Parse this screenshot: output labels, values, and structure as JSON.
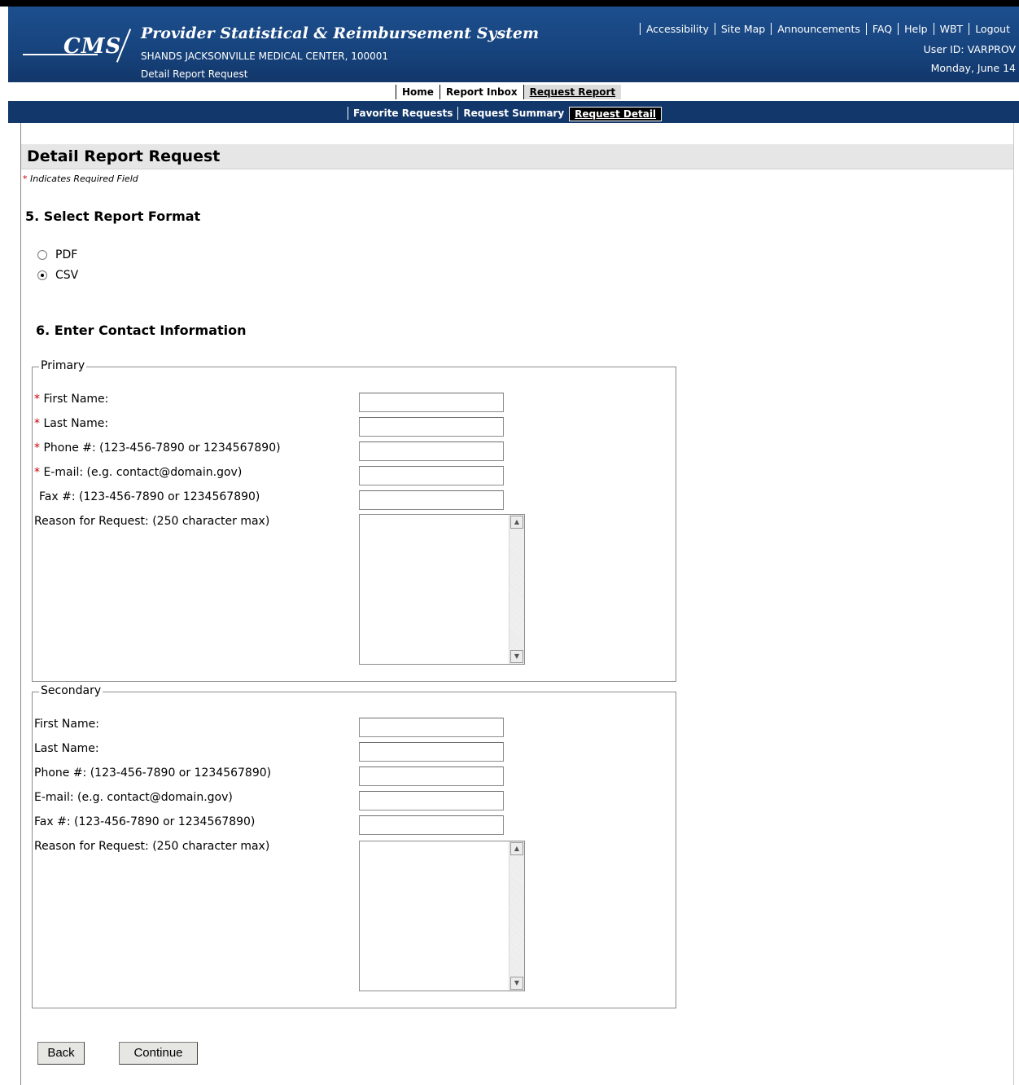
{
  "header": {
    "logo_text": "CMS",
    "app_title": "Provider Statistical & Reimbursement System",
    "facility": "SHANDS JACKSONVILLE MEDICAL CENTER, 100001",
    "page_name": "Detail Report Request",
    "links": [
      "Accessibility",
      "Site Map",
      "Announcements",
      "FAQ",
      "Help",
      "WBT",
      "Logout"
    ],
    "user_id": "User ID: VARPROV",
    "date": "Monday, June 14"
  },
  "nav_primary": {
    "home": "Home",
    "report_inbox": "Report Inbox",
    "request_report": "Request Report"
  },
  "nav_secondary": {
    "favorite_requests": "Favorite Requests",
    "request_summary": "Request Summary",
    "request_detail": "Request Detail"
  },
  "page": {
    "title": "Detail Report Request",
    "required_star": "*",
    "required_note": "Indicates Required Field"
  },
  "step5": {
    "title": "5.  Select Report Format",
    "options": [
      {
        "label": "PDF",
        "selected": false
      },
      {
        "label": "CSV",
        "selected": true
      }
    ]
  },
  "step6": {
    "title": "6.  Enter Contact Information",
    "primary": {
      "legend": "Primary",
      "first_name": "First Name:",
      "last_name": "Last Name:",
      "phone": "Phone #: (123-456-7890 or 1234567890)",
      "email": "E-mail: (e.g. contact@domain.gov)",
      "fax": "Fax #: (123-456-7890 or 1234567890)",
      "reason": "Reason for Request: (250 character max)",
      "first_name_value": "",
      "last_name_value": "",
      "phone_value": "",
      "email_value": "",
      "fax_value": "",
      "reason_value": ""
    },
    "secondary": {
      "legend": "Secondary",
      "first_name": "First Name:",
      "last_name": "Last Name:",
      "phone": "Phone #: (123-456-7890 or 1234567890)",
      "email": "E-mail: (e.g. contact@domain.gov)",
      "fax": "Fax #: (123-456-7890 or 1234567890)",
      "reason": "Reason for Request: (250 character max)",
      "first_name_value": "",
      "last_name_value": "",
      "phone_value": "",
      "email_value": "",
      "fax_value": "",
      "reason_value": ""
    }
  },
  "buttons": {
    "back": "Back",
    "continue": "Continue"
  },
  "icons": {
    "scroll_up": "scroll-up-arrow-icon",
    "scroll_down": "scroll-down-arrow-icon"
  }
}
